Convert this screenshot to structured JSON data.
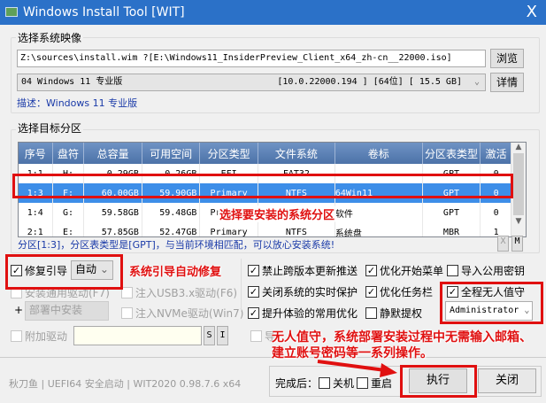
{
  "window": {
    "title": "Windows Install Tool [WIT]",
    "close": "X"
  },
  "image": {
    "group_label": "选择系统映像",
    "path": "Z:\\sources\\install.wim ?[E:\\Windows11_InsiderPreview_Client_x64_zh-cn__22000.iso]",
    "browse": "浏览",
    "edition_index": "04  Windows 11 专业版",
    "edition_info": "[10.0.22000.194 ] [64位] [ 15.5 GB]",
    "details": "详情",
    "description": "描述：Windows 11 专业版"
  },
  "partition": {
    "group_label": "选择目标分区",
    "columns": [
      "序号",
      "盘符",
      "总容量",
      "可用空间",
      "分区类型",
      "文件系统",
      "卷标",
      "分区表类型",
      "激活"
    ],
    "rows": [
      [
        "1:1",
        "H:",
        "0.29GB",
        "0.26GB",
        "EFI",
        "FAT32",
        "",
        "GPT",
        "0"
      ],
      [
        "1:3",
        "F:",
        "60.00GB",
        "59.90GB",
        "Primary",
        "NTFS",
        "64Win11",
        "GPT",
        "0"
      ],
      [
        "1:4",
        "G:",
        "59.58GB",
        "59.48GB",
        "Primary",
        "NTFS",
        "软件",
        "GPT",
        "0"
      ],
      [
        "2:1",
        "E:",
        "57.85GB",
        "52.47GB",
        "Primary",
        "NTFS",
        "系统盘",
        "MBR",
        "1"
      ]
    ],
    "status": "分区[1:3]，分区表类型是[GPT]，与当前环境相匹配，可以放心安装系统!",
    "btn_x": "X",
    "btn_m": "M"
  },
  "options": {
    "repair_boot": "修复引导",
    "repair_mode": "自动",
    "install_drivers": "安装通用驱动(F7)",
    "usb3": "注入USB3.x驱动(F6)",
    "plus": "+",
    "deploy": "部署中安装",
    "nvme": "注入NVMe驱动(Win7)",
    "extra_drivers": "附加驱动",
    "s": "S",
    "i": "I",
    "import_partial": "导",
    "block_update": "禁止跨版本更新推送",
    "disable_protection": "关闭系统的实时保护",
    "common_opt": "提升体验的常用优化",
    "opt_start": "优化开始菜单",
    "opt_taskbar": "优化任务栏",
    "silent": "静默提权",
    "import_key": "导入公用密钥",
    "unattended": "全程无人值守",
    "account": "Administrator"
  },
  "annotations": {
    "select_partition": "选择要安装的系统分区",
    "boot_repair": "系统引导自动修复",
    "unattended_1": "无人值守，系统部署安装过程中无需输入邮箱、",
    "unattended_2": "建立账号密码等一系列操作。"
  },
  "footer": {
    "status": "秋刀鱼 | UEFI64 安全启动 | WIT2020 0.98.7.6 x64",
    "after": "完成后：",
    "shutdown": "关机",
    "restart": "重启",
    "execute": "执行",
    "close": "关闭"
  }
}
